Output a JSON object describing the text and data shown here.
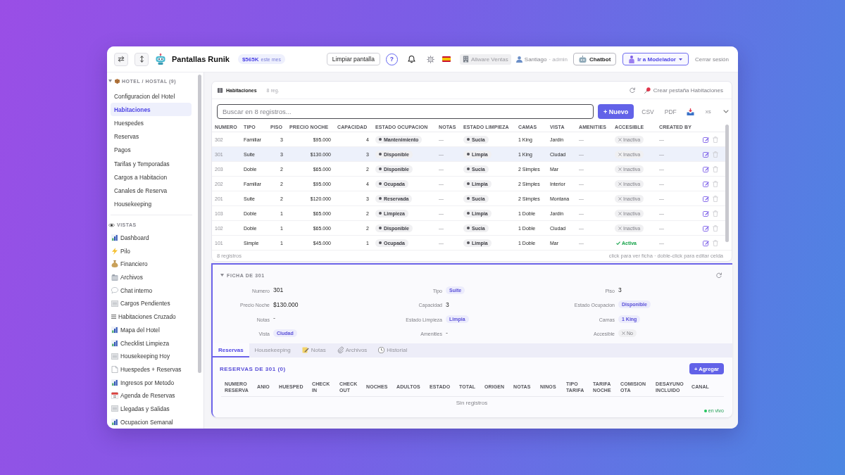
{
  "header": {
    "title": "Pantallas Runik",
    "revenue": {
      "amount": "$565K",
      "period": "este mes"
    },
    "clear_button": "Limpiar pantalla",
    "help_button": "?",
    "company": "Allware Ventas",
    "user": {
      "name": "Santiago",
      "role": "· admin"
    },
    "chatbot_button": "Chatbot",
    "modeler_button": "Ir a Modelador",
    "logout_link": "Cerrar sesión"
  },
  "sidebar": {
    "modules": {
      "title": "HOTEL / HOSTAL (9)",
      "expanded": true,
      "items": [
        {
          "label": "Configuracion del Hotel",
          "selected": false
        },
        {
          "label": "Habitaciones",
          "selected": true
        },
        {
          "label": "Huespedes",
          "selected": false
        },
        {
          "label": "Reservas",
          "selected": false
        },
        {
          "label": "Pagos",
          "selected": false
        },
        {
          "label": "Tarifas y Temporadas",
          "selected": false
        },
        {
          "label": "Cargos a Habitacion",
          "selected": false
        },
        {
          "label": "Canales de Reserva",
          "selected": false
        },
        {
          "label": "Housekeeping",
          "selected": false
        }
      ]
    },
    "views": {
      "title": "VISTAS",
      "items": [
        {
          "label": "Dashboard",
          "selected": false
        },
        {
          "label": "Pilo",
          "selected": false
        },
        {
          "label": "Financiero",
          "selected": false
        },
        {
          "label": "Archivos",
          "selected": false
        },
        {
          "label": "Chat interno",
          "selected": false
        },
        {
          "label": "Cargos Pendientes",
          "selected": false
        },
        {
          "label": "Habitaciones Cruzado",
          "selected": false
        },
        {
          "label": "Mapa del Hotel",
          "selected": false
        },
        {
          "label": "Checklist Limpieza",
          "selected": false
        },
        {
          "label": "Housekeeping Hoy",
          "selected": false
        },
        {
          "label": "Huespedes + Reservas",
          "selected": false
        },
        {
          "label": "Ingresos por Metodo",
          "selected": false
        },
        {
          "label": "Agenda de Reservas",
          "selected": false
        },
        {
          "label": "Llegadas y Salidas",
          "selected": false
        },
        {
          "label": "Ocupacion Semanal",
          "selected": false
        }
      ]
    }
  },
  "table_panel": {
    "title": "Habitaciones",
    "count": "8 reg.",
    "create_tab_link": "Crear pestaña Habitaciones",
    "search": {
      "placeholder": "Buscar en 8 registros..."
    },
    "new_button": "+ Nuevo",
    "export_buttons": [
      "CSV",
      "PDF"
    ],
    "size_toggle": "xs",
    "columns": [
      {
        "label": "NUMERO",
        "kind": "id"
      },
      {
        "label": "TIPO",
        "kind": "text"
      },
      {
        "label": "PISO",
        "kind": "number"
      },
      {
        "label": "PRECIO NOCHE",
        "kind": "number"
      },
      {
        "label": "CAPACIDAD",
        "kind": "number"
      },
      {
        "label": "ESTADO OCUPACION",
        "kind": "status"
      },
      {
        "label": "NOTAS",
        "kind": "muted"
      },
      {
        "label": "ESTADO LIMPIEZA",
        "kind": "status"
      },
      {
        "label": "CAMAS",
        "kind": "text"
      },
      {
        "label": "VISTA",
        "kind": "text"
      },
      {
        "label": "AMENITIES",
        "kind": "muted"
      },
      {
        "label": "ACCESIBLE",
        "kind": "flag"
      },
      {
        "label": "CREATED BY",
        "kind": "muted"
      }
    ],
    "rows": [
      {
        "selected": false,
        "cells": [
          "302",
          "Familiar",
          "3",
          "$95.000",
          "4",
          "Mantenimiento",
          "—",
          "Sucia",
          "1 King",
          "Jardin",
          "—",
          {
            "label": "Inactiva",
            "active": false
          },
          "—"
        ]
      },
      {
        "selected": true,
        "cells": [
          "301",
          "Suite",
          "3",
          "$130.000",
          "3",
          "Disponible",
          "—",
          "Limpia",
          "1 King",
          "Ciudad",
          "—",
          {
            "label": "Inactiva",
            "active": false
          },
          "—"
        ]
      },
      {
        "selected": false,
        "cells": [
          "203",
          "Doble",
          "2",
          "$65.000",
          "2",
          "Disponible",
          "—",
          "Sucia",
          "2 Simples",
          "Mar",
          "—",
          {
            "label": "Inactiva",
            "active": false
          },
          "—"
        ]
      },
      {
        "selected": false,
        "cells": [
          "202",
          "Familiar",
          "2",
          "$95.000",
          "4",
          "Ocupada",
          "—",
          "Limpia",
          "2 Simples",
          "Interior",
          "—",
          {
            "label": "Inactiva",
            "active": false
          },
          "—"
        ]
      },
      {
        "selected": false,
        "cells": [
          "201",
          "Suite",
          "2",
          "$120.000",
          "3",
          "Reservada",
          "—",
          "Sucia",
          "2 Simples",
          "Montana",
          "—",
          {
            "label": "Inactiva",
            "active": false
          },
          "—"
        ]
      },
      {
        "selected": false,
        "cells": [
          "103",
          "Doble",
          "1",
          "$65.000",
          "2",
          "Limpieza",
          "—",
          "Limpia",
          "1 Doble",
          "Jardin",
          "—",
          {
            "label": "Inactiva",
            "active": false
          },
          "—"
        ]
      },
      {
        "selected": false,
        "cells": [
          "102",
          "Doble",
          "1",
          "$65.000",
          "2",
          "Disponible",
          "—",
          "Sucia",
          "1 Doble",
          "Ciudad",
          "—",
          {
            "label": "Inactiva",
            "active": false
          },
          "—"
        ]
      },
      {
        "selected": false,
        "cells": [
          "101",
          "Simple",
          "1",
          "$45.000",
          "1",
          "Ocupada",
          "—",
          "Limpia",
          "1 Doble",
          "Mar",
          "—",
          {
            "label": "Activa",
            "active": true
          },
          "—"
        ]
      }
    ],
    "footer": {
      "count": "8 registros",
      "hint": "click para ver ficha · doble-click para editar celda"
    }
  },
  "detail_panel": {
    "title": "FICHA DE 301",
    "expanded": true,
    "fields": [
      {
        "label": "Numero",
        "value": "301",
        "kind": "plain"
      },
      {
        "label": "Tipo",
        "value": "Suite",
        "kind": "tag"
      },
      {
        "label": "Piso",
        "value": "3",
        "kind": "plain"
      },
      {
        "label": "Precio Noche",
        "value": "$130.000",
        "kind": "plain"
      },
      {
        "label": "Capacidad",
        "value": "3",
        "kind": "plain"
      },
      {
        "label": "Estado Ocupacion",
        "value": "Disponible",
        "kind": "tag"
      },
      {
        "label": "Notas",
        "value": "-",
        "kind": "empty"
      },
      {
        "label": "Estado Limpieza",
        "value": "Limpia",
        "kind": "tag"
      },
      {
        "label": "Camas",
        "value": "1 King",
        "kind": "tag"
      },
      {
        "label": "Vista",
        "value": "Ciudad",
        "kind": "tag"
      },
      {
        "label": "Amenities",
        "value": "-",
        "kind": "empty"
      },
      {
        "label": "Accesible",
        "value": "No",
        "kind": "flag",
        "active": false
      }
    ],
    "tabs": [
      {
        "label": "Reservas",
        "selected": true
      },
      {
        "label": "Housekeeping",
        "selected": false
      },
      {
        "label": "Notas",
        "selected": false
      },
      {
        "label": "Archivos",
        "selected": false
      },
      {
        "label": "Historial",
        "selected": false
      }
    ],
    "reservations": {
      "title": "RESERVAS DE 301 (0)",
      "add_button": "+ Agregar",
      "columns": [
        "NUMERO RESERVA",
        "ANIO",
        "HUESPED",
        "CHECK IN",
        "CHECK OUT",
        "NOCHES",
        "ADULTOS",
        "ESTADO",
        "TOTAL",
        "ORIGEN",
        "NOTAS",
        "NINOS",
        "TIPO TARIFA",
        "TARIFA NOCHE",
        "COMISION OTA",
        "DESAYUNO INCLUIDO",
        "CANAL"
      ],
      "empty_text": "Sin registros",
      "live_label": "en vivo"
    }
  }
}
